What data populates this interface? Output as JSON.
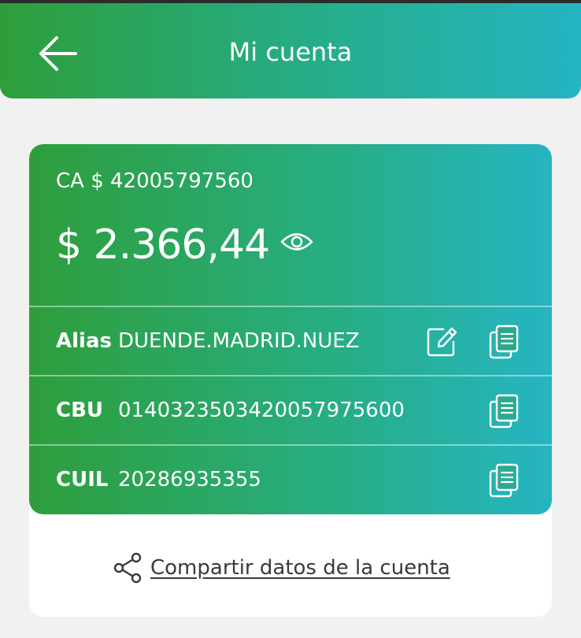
{
  "header": {
    "title": "Mi cuenta",
    "back_icon": "arrow-left-icon"
  },
  "account": {
    "number": "CA $ 42005797560",
    "balance": "$ 2.366,44",
    "visibility_icon": "eye-icon"
  },
  "rows": [
    {
      "label": "Alias",
      "value": "DUENDE.MADRID.NUEZ",
      "icons": [
        "edit-icon",
        "copy-icon"
      ]
    },
    {
      "label": "CBU",
      "value": "0140323503420057975600",
      "icons": [
        "copy-icon"
      ]
    },
    {
      "label": "CUIL",
      "value": "20286935355",
      "icons": [
        "copy-icon"
      ]
    }
  ],
  "share": {
    "label": "Compartir datos de la cuenta",
    "icon": "share-icon"
  },
  "colors": {
    "gradient_start": "#2e9e3b",
    "gradient_end": "#25b5c2",
    "background": "#f1f1f1",
    "card": "#ffffff",
    "text_dark": "#3a3a3a"
  }
}
